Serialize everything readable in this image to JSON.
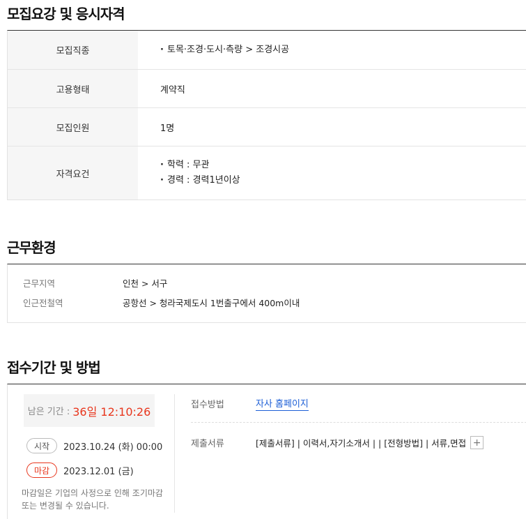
{
  "recruit": {
    "title": "모집요강 및 응시자격",
    "rows": [
      {
        "label": "모집직종",
        "lines": [
          "토목·조경·도시·측량 > 조경시공"
        ],
        "bullet": true
      },
      {
        "label": "고용형태",
        "lines": [
          "계약직"
        ],
        "bullet": false
      },
      {
        "label": "모집인원",
        "lines": [
          "1명"
        ],
        "bullet": false
      },
      {
        "label": "자격요건",
        "lines": [
          "학력 : 무관",
          "경력 : 경력1년이상"
        ],
        "bullet": true
      }
    ]
  },
  "environment": {
    "title": "근무환경",
    "location_label": "근무지역",
    "location_value": "인천 > 서구",
    "subway_label": "인근전철역",
    "subway_value": "공항선 > 청라국제도시 1번출구에서 400m이내"
  },
  "application": {
    "title": "접수기간 및 방법",
    "remaining_label": "남은 기간 :",
    "remaining_time": "36일 12:10:26",
    "start_badge": "시작",
    "start_date": "2023.10.24 (화) 00:00",
    "end_badge": "마감",
    "end_date": "2023.12.01 (금)",
    "notice": "마감일은 기업의 사정으로 인해 조기마감 또는 변경될 수 있습니다.",
    "method_label": "접수방법",
    "method_link": "자사 홈페이지",
    "docs_label": "제출서류",
    "docs_value": "[제출서류] | 이력서,자기소개서 | | [전형방법] | 서류,면접",
    "docs_more": "+"
  },
  "colors": {
    "accent_red": "#e8361d",
    "link_blue": "#1d5fd6"
  }
}
